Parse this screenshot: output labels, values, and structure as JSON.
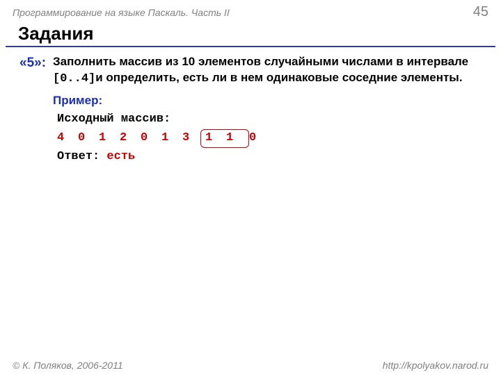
{
  "header": {
    "course": "Программирование на языке Паскаль. Часть II",
    "page": "45"
  },
  "title": "Задания",
  "task": {
    "grade": "«5»:",
    "text_before_interval": "Заполнить массив из 10 элементов случайными числами в интервале ",
    "interval": "[0..4]",
    "text_after_interval": "и определить, есть ли в нем одинаковые соседние элементы."
  },
  "example": {
    "label": "Пример:",
    "array_label": "Исходный массив:",
    "values": [
      "4",
      "0",
      "1",
      "2",
      "0",
      "1",
      "3",
      "1",
      "1",
      "0"
    ],
    "highlight_start": 7,
    "highlight_end": 8,
    "answer_label": "Ответ: ",
    "answer_value": "есть"
  },
  "footer": {
    "copyright": "© К. Поляков, 2006-2011",
    "url": "http://kpolyakov.narod.ru"
  }
}
